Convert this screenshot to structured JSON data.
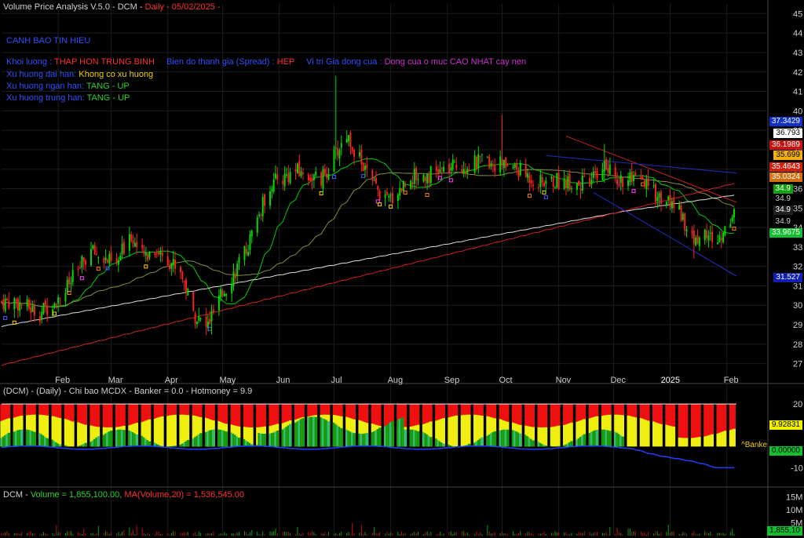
{
  "header": {
    "title": "Volume Price Analysis V.5.0 - DCM -",
    "period": "Daily",
    "date": "- 05/02/2025 -"
  },
  "signals": {
    "heading": "CANH BAO TIN HIEU",
    "vol_label": "Khoi luong :",
    "vol_value": "THAP HON TRUNG BINH",
    "spread_label": "Bien do thanh gia (Spread) :",
    "spread_value": "HEP",
    "close_label": "Vi tri Gia dong cua :",
    "close_value": "Dong cua o muc CAO NHAT cay nen",
    "long_label": "Xu huong dai han:",
    "long_value": "Khong co xu huong",
    "short_label": "Xu huong ngan han:",
    "short_value": "TANG - UP",
    "mid_label": "Xu huong trung han:",
    "mid_value": "TANG - UP"
  },
  "mcdx_title": "(DCM) - (Daily) - Chi bao MCDX - Banker = 0.0 - Hotmoney = 9.9",
  "volume_title": {
    "prefix": "DCM - ",
    "vol": "Volume = 1,855,100.00,",
    "ma": "MA(Volume,20) = 1,536,545.00"
  },
  "price_axis": {
    "ticks": [
      "45",
      "44",
      "43",
      "42",
      "41",
      "40",
      "39",
      "38",
      "37",
      "36",
      "35",
      "34",
      "33",
      "32",
      "31",
      "30",
      "29",
      "28",
      "27"
    ],
    "labels": [
      {
        "text": "37.3429",
        "bg": "#1030c8",
        "fg": "#ffffff"
      },
      {
        "text": "36.793",
        "bg": "#ffffff",
        "fg": "#000000"
      },
      {
        "text": "36.1989",
        "bg": "#cc1010",
        "fg": "#ffffff"
      },
      {
        "text": "35.699",
        "bg": "#f0b010",
        "fg": "#000000"
      },
      {
        "text": "35.4643",
        "bg": "#d02010",
        "fg": "#ffffff"
      },
      {
        "text": "35.0324",
        "bg": "#d07010",
        "fg": "#ffffff"
      },
      {
        "text": "34.9",
        "bg": "#10a010",
        "fg": "#ffffff"
      },
      {
        "text": "34.9",
        "bg": "#000000",
        "fg": "#cccccc"
      },
      {
        "text": "34.9",
        "bg": "#202020",
        "fg": "#ffffff"
      },
      {
        "text": "34.9",
        "bg": "#000000",
        "fg": "#cccccc"
      },
      {
        "text": "33.9675",
        "bg": "#10c030",
        "fg": "#ffffff"
      },
      {
        "text": "31.527",
        "bg": "#1020b0",
        "fg": "#ffffff"
      }
    ]
  },
  "mcdx_axis": {
    "ticks": [
      "20",
      "10",
      "-10"
    ],
    "labels": [
      {
        "text": "9.92831",
        "bg": "#f0f000",
        "fg": "#000000"
      },
      {
        "text": "0.00000",
        "bg": "#10c030",
        "fg": "#000000"
      }
    ],
    "banker_tag": "^Banke"
  },
  "volume_axis": {
    "ticks": [
      "15M",
      "10M",
      "5M"
    ],
    "label": {
      "text": "1,855,10",
      "bg": "#10c030",
      "fg": "#000000"
    }
  },
  "x_axis": {
    "months": [
      "Feb",
      "Mar",
      "Apr",
      "May",
      "Jun",
      "Jul",
      "Aug",
      "Sep",
      "Oct",
      "Nov",
      "Dec",
      "2025",
      "Feb"
    ]
  },
  "chart_data": {
    "type": "candlestick",
    "symbol": "DCM",
    "period": "Daily",
    "ylim": [
      26.5,
      45.5
    ],
    "close_anchors": [
      [
        "2024-01-08",
        30.2
      ],
      [
        "2024-01-22",
        29.6
      ],
      [
        "2024-02-05",
        30.8
      ],
      [
        "2024-02-19",
        32.8
      ],
      [
        "2024-03-04",
        32.0
      ],
      [
        "2024-03-11",
        33.8
      ],
      [
        "2024-03-18",
        32.5
      ],
      [
        "2024-03-25",
        32.9
      ],
      [
        "2024-04-01",
        32.4
      ],
      [
        "2024-04-08",
        31.8
      ],
      [
        "2024-04-15",
        29.6
      ],
      [
        "2024-04-22",
        28.8
      ],
      [
        "2024-05-02",
        30.8
      ],
      [
        "2024-05-13",
        32.6
      ],
      [
        "2024-05-27",
        36.2
      ],
      [
        "2024-06-10",
        36.9
      ],
      [
        "2024-06-24",
        36.4
      ],
      [
        "2024-07-08",
        38.8
      ],
      [
        "2024-07-22",
        36.2
      ],
      [
        "2024-07-30",
        35.3
      ],
      [
        "2024-08-12",
        36.6
      ],
      [
        "2024-08-26",
        36.8
      ],
      [
        "2024-09-09",
        37.2
      ],
      [
        "2024-09-23",
        37.4
      ],
      [
        "2024-10-07",
        37.1
      ],
      [
        "2024-10-21",
        36.3
      ],
      [
        "2024-11-04",
        36.4
      ],
      [
        "2024-11-18",
        36.2
      ],
      [
        "2024-11-25",
        37.3
      ],
      [
        "2024-12-02",
        36.5
      ],
      [
        "2024-12-16",
        36.3
      ],
      [
        "2024-12-27",
        35.5
      ],
      [
        "2025-01-06",
        35.0
      ],
      [
        "2025-01-13",
        33.3
      ],
      [
        "2025-01-20",
        33.7
      ],
      [
        "2025-01-27",
        33.2
      ],
      [
        "2025-02-05",
        34.9
      ]
    ],
    "overlays": {
      "ma_fast_color": "#00cc00",
      "ma_mid_color": "#dddddd",
      "ma_slow_color": "#cc2020",
      "resistance_color": "#cc2020",
      "support_color": "#2030c0"
    },
    "mcdx": {
      "banker": 0.0,
      "hotmoney": 9.9,
      "ylim": [
        -15,
        23
      ]
    },
    "volume": {
      "last": 1855100,
      "ma20": 1536545,
      "ylim": [
        0,
        17000000
      ]
    },
    "colors": {
      "up": "#00dd00",
      "down": "#ff2020",
      "grid": "#1c1c1c"
    }
  }
}
